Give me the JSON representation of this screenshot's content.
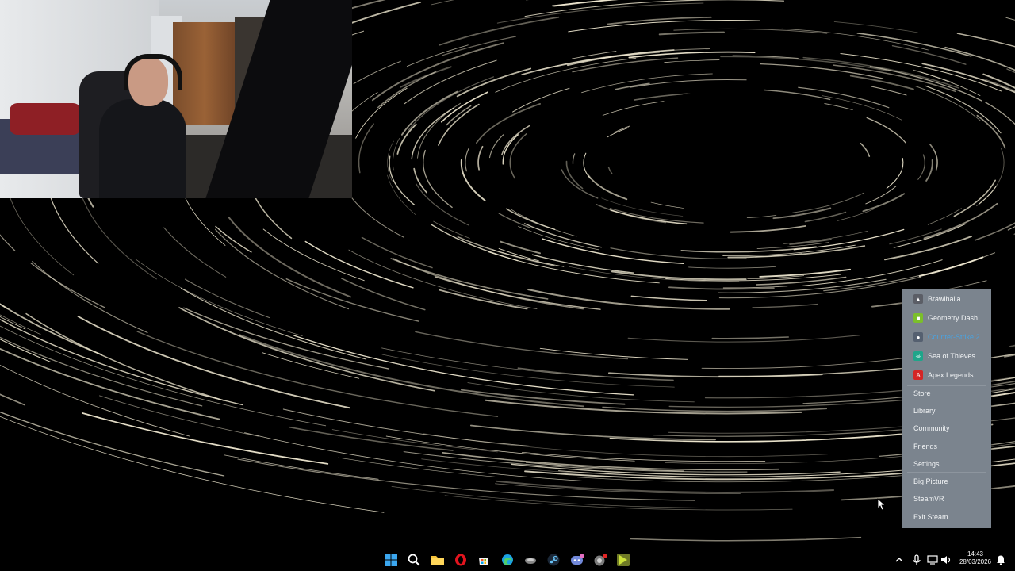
{
  "steam_menu": {
    "games": [
      {
        "label": "Brawlhalla",
        "icon": "brawlhalla-icon",
        "color": "#6d6f76"
      },
      {
        "label": "Geometry Dash",
        "icon": "geometry-dash-icon",
        "color": "#7bbf2a"
      },
      {
        "label": "Counter-Strike 2",
        "icon": "counter-strike-2-icon",
        "color": "#3a6ea8",
        "text_color": "#4aa3e0"
      },
      {
        "label": "Sea of Thieves",
        "icon": "sea-of-thieves-icon",
        "color": "#1fa58a"
      },
      {
        "label": "Apex Legends",
        "icon": "apex-legends-icon",
        "color": "#d42525"
      }
    ],
    "items": [
      "Store",
      "Library",
      "Community",
      "Friends",
      "Settings",
      "Big Picture",
      "SteamVR",
      "Exit Steam"
    ]
  },
  "taskbar": {
    "icons": [
      "windows-start-icon",
      "search-icon",
      "file-explorer-icon",
      "opera-icon",
      "microsoft-store-icon",
      "edge-icon",
      "app-icon",
      "steam-icon",
      "discord-icon",
      "app-icon-2",
      "app-icon-3"
    ],
    "tray_icons": [
      "chevron-up-icon",
      "microphone-icon",
      "network-icon",
      "volume-icon",
      "notification-icon"
    ]
  },
  "clock": {
    "time": "14:43",
    "date": "28/03/2026"
  },
  "colors": {
    "menu_background": "#7b848e",
    "wallpaper": "#000000",
    "star_trails": "#f1ead2"
  }
}
